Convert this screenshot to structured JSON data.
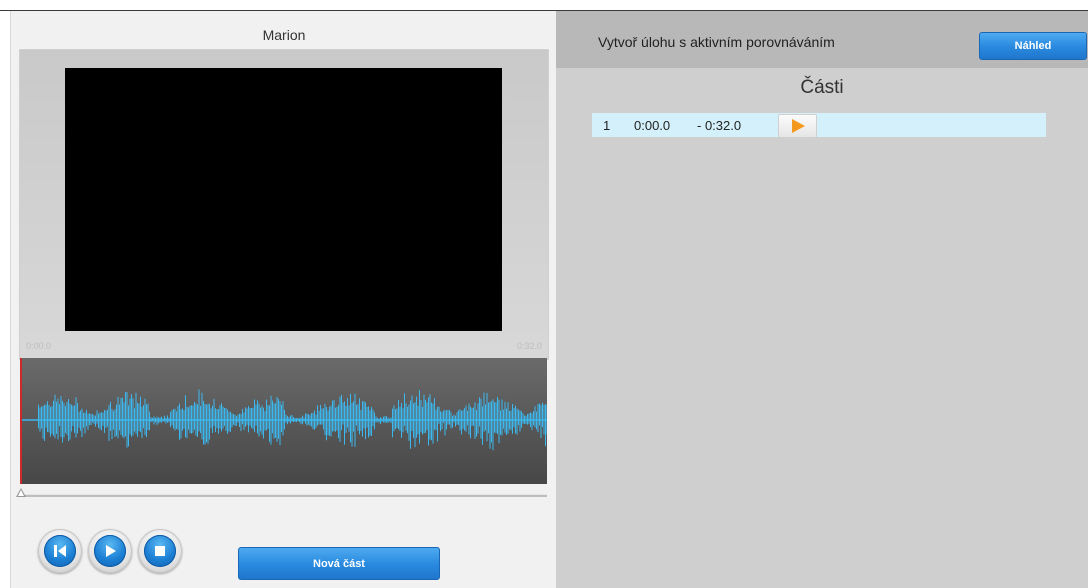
{
  "media": {
    "title": "Marion",
    "time_start": "0:00.0",
    "time_end": "0:32.0"
  },
  "controls": {
    "new_part_label": "Nová část"
  },
  "task": {
    "title": "Vytvoř úlohu s aktivním porovnáváním",
    "preview_label": "Náhled"
  },
  "parts": {
    "heading": "Části",
    "items": [
      {
        "number": "1",
        "start": "0:00.0",
        "end": "- 0:32.0"
      }
    ]
  },
  "colors": {
    "waveform": "#3db8ef",
    "accent_button": "#2a8be0",
    "play_orange": "#f39a1e",
    "row_highlight": "#d4f0fa",
    "playhead": "#cc2a2a"
  },
  "icons": {
    "skip_back": "skip-to-start-icon",
    "play": "play-icon",
    "stop": "stop-icon",
    "part_play": "play-orange-icon"
  }
}
